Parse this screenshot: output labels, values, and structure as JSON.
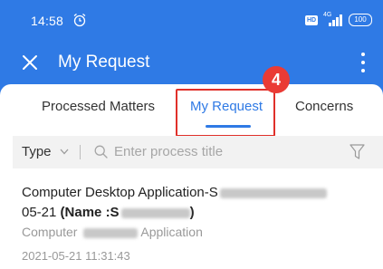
{
  "status_bar": {
    "time": "14:58",
    "hd": "HD",
    "network": "4G",
    "battery": "100"
  },
  "header": {
    "title": "My Request"
  },
  "tabs": [
    {
      "label": "Processed Matters",
      "active": false
    },
    {
      "label": "My Request",
      "active": true
    },
    {
      "label": "Concerns",
      "active": false
    }
  ],
  "annotation": {
    "step": "4"
  },
  "filter": {
    "type_label": "Type",
    "search_placeholder": "Enter process title"
  },
  "request": {
    "title_prefix": "Computer Desktop Application-S",
    "title_end": "05-21",
    "name_label": "(Name :S",
    "name_close": ")",
    "app_prefix": "Computer",
    "app_suffix": "Application",
    "timestamp": "2021-05-21 11:31:43"
  },
  "colors": {
    "primary": "#2f7ae5",
    "annotation": "#e0302a"
  }
}
